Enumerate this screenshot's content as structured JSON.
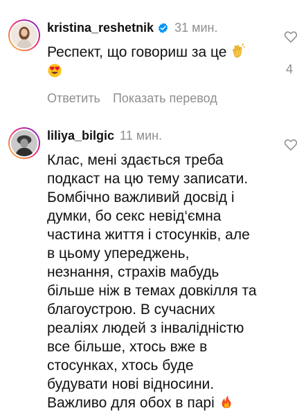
{
  "comments": [
    {
      "username": "kristina_reshetnik",
      "verified": true,
      "time": "31 мин.",
      "text": "Респект, що говориш за це",
      "emojis": [
        "clapping-hands-emoji",
        "heart-eyes-emoji"
      ],
      "reply_label": "Ответить",
      "translate_label": "Показать перевод",
      "side_count": "4"
    },
    {
      "username": "liliya_bilgic",
      "verified": false,
      "time": "11 мин.",
      "text": "Клас, мені здається треба\nподкаст на цю тему записати.\nБомбічно важливий досвід і\nдумки, бо секс невід‘ємна\nчастина життя і стосунків, але\nв цьому упереджень,\nнезнання, страхів мабудь\nбільше ніж в темах довкілля та\nблагоустрою. В сучасних\nреаліях людей з інвалідністю\nвсе більше, хтось вже в\nстосунках, хтось буде\nбудувати нові відносини.\nВажливо для обох в парі",
      "emojis": [
        "fire-emoji"
      ]
    }
  ]
}
